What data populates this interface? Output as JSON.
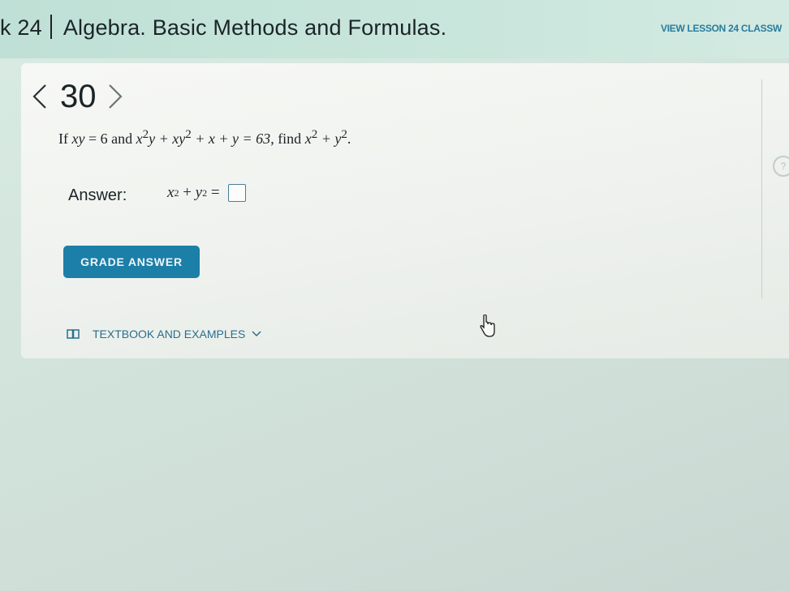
{
  "header": {
    "breadcrumb_prefix": "k 24",
    "title": "Algebra. Basic Methods and Formulas.",
    "view_lesson_label": "VIEW LESSON 24 CLASSW"
  },
  "problem": {
    "number": "30",
    "q_if": "If",
    "q_xy": "xy",
    "q_eq6": " = 6",
    "q_and": " and",
    "q_x": "x",
    "q_exp2a": "2",
    "q_y_plus_xy": "y + xy",
    "q_exp2b": "2",
    "q_rest": " + x + y = 63",
    "q_find": ", find",
    "q_x2": "x",
    "q_exp2c": "2",
    "q_plus_y": " + y",
    "q_exp2d": "2",
    "q_period": "."
  },
  "answer": {
    "label": "Answer:",
    "x": "x",
    "exp_x": "2",
    "plus": " + ",
    "y": "y",
    "exp_y": "2",
    "equals": " = "
  },
  "grade_button_label": "GRADE ANSWER",
  "textbook_label": "TEXTBOOK AND EXAMPLES",
  "colors": {
    "accent": "#1b7fa8",
    "link": "#2a6f8c"
  }
}
